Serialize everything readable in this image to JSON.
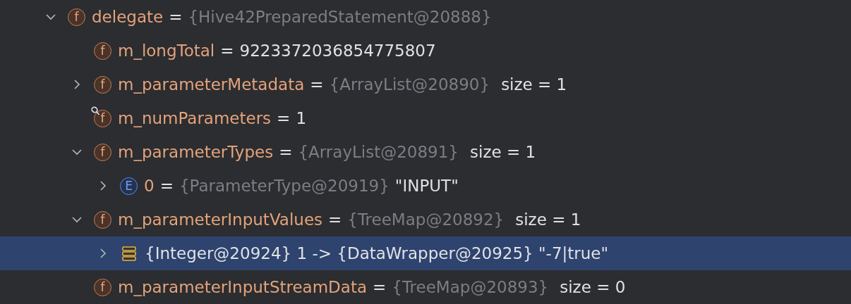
{
  "tree": [
    {
      "kind": "field",
      "badge": "f",
      "name": "delegate",
      "op": "=",
      "type_ref": "{Hive42PreparedStatement@20888}",
      "expanded": true,
      "watched": false,
      "selected": false,
      "children": [
        {
          "kind": "field",
          "badge": "f",
          "name": "m_longTotal",
          "op": "=",
          "value": "9223372036854775807",
          "watched": false,
          "selected": false
        },
        {
          "kind": "field",
          "badge": "f",
          "name": "m_parameterMetadata",
          "op": "=",
          "type_ref": "{ArrayList@20890}",
          "size": "size = 1",
          "expanded": false,
          "watched": false,
          "selected": false
        },
        {
          "kind": "field",
          "badge": "f",
          "name": "m_numParameters",
          "op": "=",
          "value": "1",
          "watched": true,
          "selected": false
        },
        {
          "kind": "field",
          "badge": "f",
          "name": "m_parameterTypes",
          "op": "=",
          "type_ref": "{ArrayList@20891}",
          "size": "size = 1",
          "expanded": true,
          "watched": false,
          "selected": false,
          "children": [
            {
              "kind": "enum",
              "badge": "E",
              "name": "0",
              "op": "=",
              "type_ref": "{ParameterType@20919}",
              "value": "\"INPUT\"",
              "expanded": false,
              "watched": false,
              "selected": false
            }
          ]
        },
        {
          "kind": "field",
          "badge": "f",
          "name": "m_parameterInputValues",
          "op": "=",
          "type_ref": "{TreeMap@20892}",
          "size": "size = 1",
          "expanded": true,
          "watched": false,
          "selected": false,
          "children": [
            {
              "kind": "entry",
              "text": "{Integer@20924} 1 -> {DataWrapper@20925} \"-7|true\"",
              "expanded": false,
              "watched": false,
              "selected": true
            }
          ]
        },
        {
          "kind": "field",
          "badge": "f",
          "name": "m_parameterInputStreamData",
          "op": "=",
          "type_ref": "{TreeMap@20893}",
          "size": "size = 0",
          "watched": false,
          "selected": false
        }
      ]
    }
  ]
}
